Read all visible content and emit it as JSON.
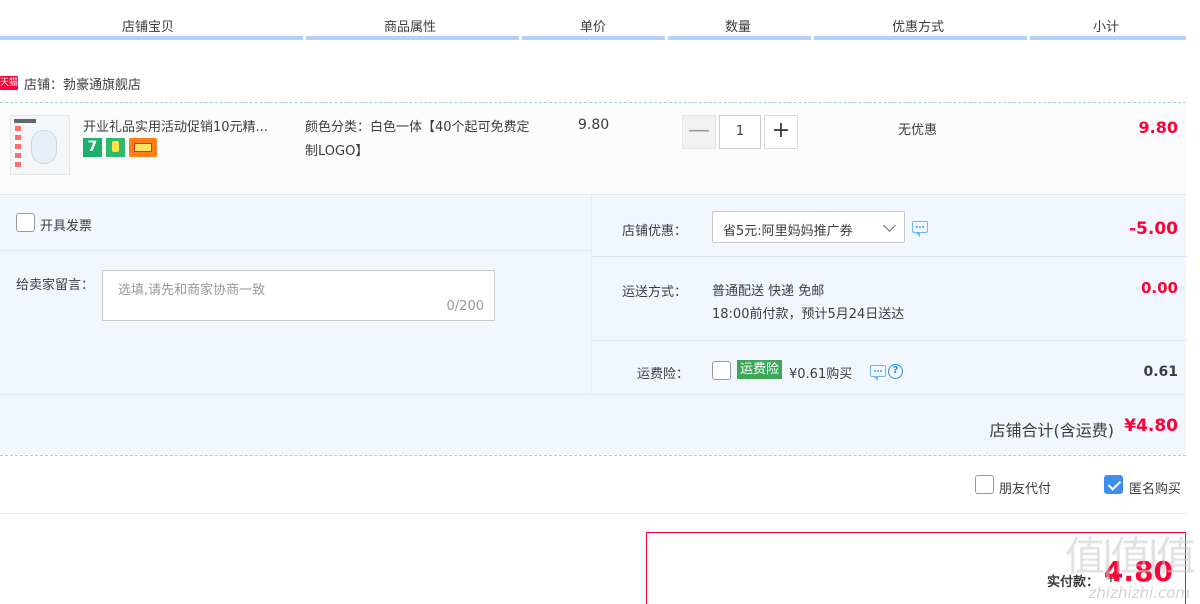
{
  "header": {
    "columns": [
      "店铺宝贝",
      "商品属性",
      "单价",
      "数量",
      "优惠方式",
      "小计"
    ]
  },
  "shop": {
    "badge": "天猫",
    "label": "店铺：勃豪通旗舰店"
  },
  "item": {
    "title": "开业礼品实用活动促销10元精...",
    "attr": "颜色分类：白色一体【40个起可免费定制LOGO】",
    "price": "9.80",
    "quantity": "1",
    "qty_minus": "—",
    "qty_plus": "+",
    "discount": "无优惠",
    "subtotal": "9.80",
    "badge7": "7"
  },
  "invoice": {
    "label": "开具发票"
  },
  "memo": {
    "label": "给卖家留言：",
    "placeholder": "选填,请先和商家协商一致",
    "count": "0/200"
  },
  "coupon": {
    "label": "店铺优惠：",
    "selected": "省5元:阿里妈妈推广券",
    "amount": "-5.00"
  },
  "shipping": {
    "label": "运送方式：",
    "method": "普通配送 快递 免邮",
    "eta": "18:00前付款，预计5月24日送达",
    "amount": "0.00"
  },
  "insurance": {
    "label": "运费险：",
    "tag": "运费险",
    "price_text": "¥0.61购买",
    "amount": "0.61"
  },
  "shop_total": {
    "label": "店铺合计(含运费)",
    "value": "¥4.80"
  },
  "options": {
    "friend_pay": "朋友代付",
    "anonymous": "匿名购买"
  },
  "payment": {
    "label": "实付款：",
    "yen": "¥",
    "value": "4.80"
  },
  "watermark": {
    "main": "值|值|值",
    "sub": "zhizhizhi.com"
  },
  "colors": {
    "accent_red": "#ff0036",
    "header_bar": "#b2d1ff",
    "panel_bg": "#f2f7ff",
    "check_blue": "#3d8fef",
    "insurance_green": "#3ca95a"
  }
}
